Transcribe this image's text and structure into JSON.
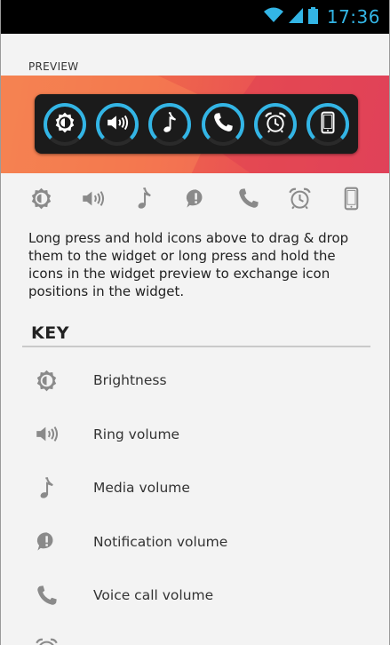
{
  "status_bar": {
    "time": "17:36",
    "icons": [
      "wifi-icon",
      "signal-icon",
      "battery-icon"
    ],
    "accent_color": "#33b5e5"
  },
  "preview": {
    "label": "PREVIEW",
    "widget_buttons": [
      {
        "name": "brightness",
        "icon": "brightness-icon",
        "level": 0.75
      },
      {
        "name": "ring-volume",
        "icon": "speaker-icon",
        "level": 0.75
      },
      {
        "name": "media-volume",
        "icon": "music-note-icon",
        "level": 0.75
      },
      {
        "name": "voice-call-volume",
        "icon": "phone-icon",
        "level": 0.75
      },
      {
        "name": "alarm-volume",
        "icon": "alarm-clock-icon",
        "level": 0.75
      },
      {
        "name": "device",
        "icon": "phone-device-icon",
        "level": 0.75
      }
    ],
    "ring_color": "#33b5e5",
    "banner_colors": [
      "#f07a4e",
      "#e54a5c"
    ]
  },
  "icon_row": [
    "brightness-icon",
    "speaker-icon",
    "music-note-icon",
    "notification-icon",
    "phone-icon",
    "alarm-clock-icon",
    "phone-device-icon"
  ],
  "description": "Long press and hold icons above to drag & drop them to the widget or long press and hold the icons in the widget preview to exchange icon positions in the widget.",
  "key": {
    "title": "KEY",
    "items": [
      {
        "icon": "brightness-icon",
        "label": "Brightness"
      },
      {
        "icon": "speaker-icon",
        "label": "Ring volume"
      },
      {
        "icon": "music-note-icon",
        "label": "Media volume"
      },
      {
        "icon": "notification-icon",
        "label": "Notification volume"
      },
      {
        "icon": "phone-icon",
        "label": "Voice call volume"
      },
      {
        "icon": "alarm-clock-icon",
        "label": ""
      }
    ]
  }
}
